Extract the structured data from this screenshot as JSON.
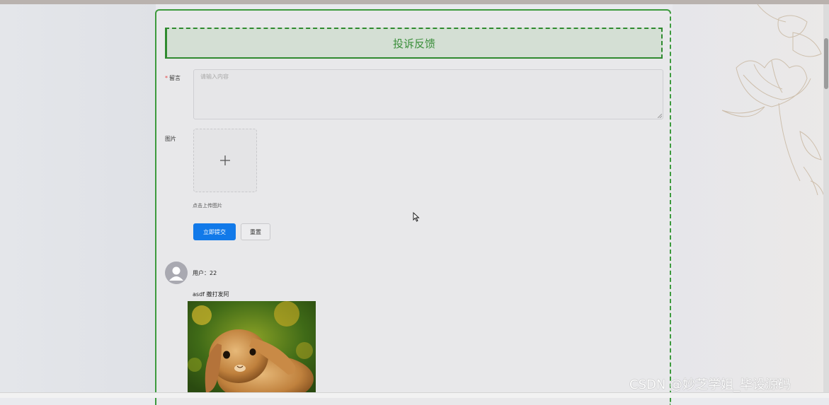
{
  "page": {
    "title": "投诉反馈",
    "accent_color": "#3b8f3b",
    "primary_color": "#1179e9"
  },
  "form": {
    "message_label": "留言",
    "required_mark": "*",
    "message_placeholder": "请输入内容",
    "message_value": "",
    "image_label": "图片",
    "upload_icon": "plus-icon",
    "upload_hint": "点击上传图片",
    "submit_label": "立即提交",
    "reset_label": "重置"
  },
  "comments": [
    {
      "avatar_icon": "user-avatar-icon",
      "user_text": "用户：22",
      "content": "asdf 撒打发阿",
      "image": "rabbit-photo"
    }
  ],
  "watermark": "CSDN @妙芝学姐_毕设源码"
}
